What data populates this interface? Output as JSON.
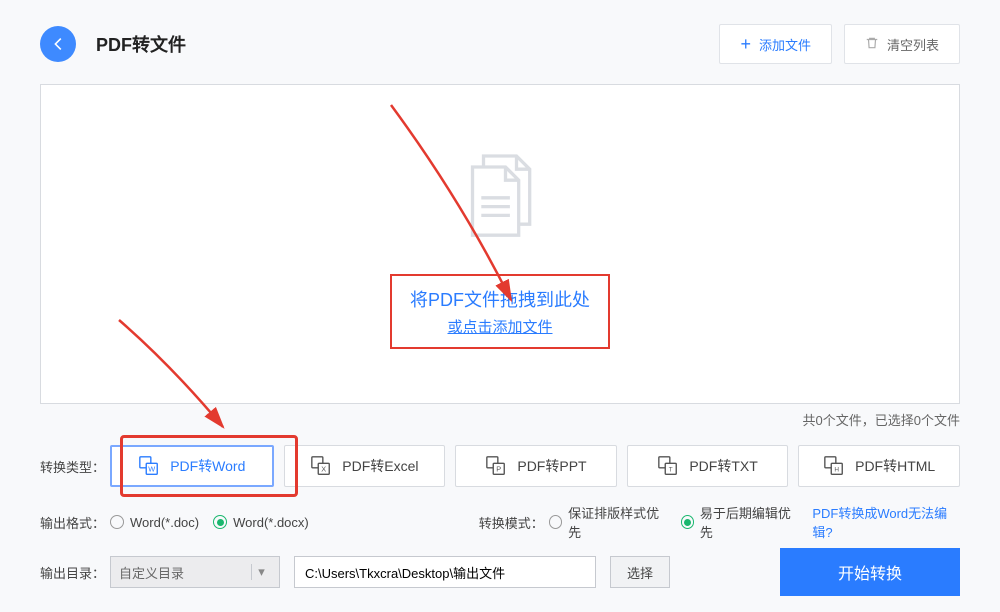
{
  "header": {
    "title": "PDF转文件",
    "add_file": "添加文件",
    "clear_list": "清空列表"
  },
  "dropzone": {
    "line1": "将PDF文件拖拽到此处",
    "line2": "或点击添加文件"
  },
  "status": {
    "text": "共0个文件，已选择0个文件"
  },
  "labels": {
    "type": "转换类型：",
    "format": "输出格式：",
    "mode": "转换模式：",
    "outdir": "输出目录："
  },
  "tabs": {
    "word": "PDF转Word",
    "excel": "PDF转Excel",
    "ppt": "PDF转PPT",
    "txt": "PDF转TXT",
    "html": "PDF转HTML"
  },
  "formats": {
    "doc": "Word(*.doc)",
    "docx": "Word(*.docx)"
  },
  "modes": {
    "layout": "保证排版样式优先",
    "edit": "易于后期编辑优先"
  },
  "help_link": "PDF转换成Word无法编辑?",
  "outdir": {
    "select": "自定义目录",
    "path": "C:\\Users\\Tkxcra\\Desktop\\输出文件",
    "browse": "选择"
  },
  "start_button": "开始转换"
}
